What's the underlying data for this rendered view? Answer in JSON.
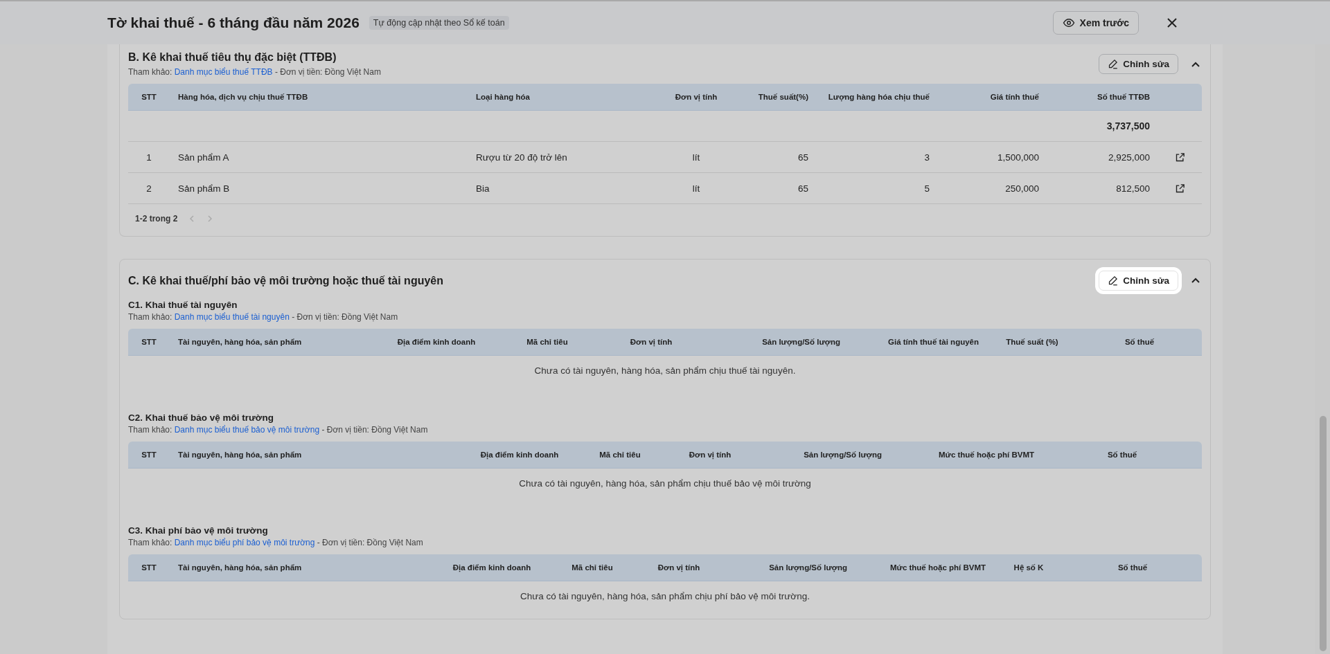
{
  "header": {
    "title": "Tờ khai thuế - 6 tháng đầu năm 2026",
    "badge": "Tự động cập nhật theo Sổ kế toán",
    "preview_button": "Xem trước"
  },
  "sections": [
    {
      "kind": "table",
      "title": "B. Kê khai thuế tiêu thụ đặc biệt (TTĐB)",
      "reference": {
        "prefix": "Tham khảo:",
        "link": "Danh mục biểu thuế TTĐB",
        "suffix": "- Đơn vị tiền: Đồng Việt Nam"
      },
      "edit_button": {
        "label": "Chỉnh sửa",
        "highlighted": false
      },
      "expanded": true,
      "table": {
        "columns": [
          "STT",
          "Hàng hóa, dịch vụ chịu thuế TTĐB",
          "Loại hàng hóa",
          "Đơn vị tính",
          "Thuế suất(%)",
          "Lượng hàng hóa chịu thuế",
          "Giá tính thuế",
          "Số thuế TTĐB"
        ],
        "total": "3,737,500",
        "rows": [
          {
            "cells": [
              "1",
              "Sản phẩm A",
              "Rượu từ 20 độ trở lên",
              "lít",
              "65",
              "3",
              "1,500,000",
              "2,925,000"
            ]
          },
          {
            "cells": [
              "2",
              "Sản phẩm B",
              "Bia",
              "lít",
              "65",
              "5",
              "250,000",
              "812,500"
            ]
          }
        ],
        "pagination": "1-2 trong 2"
      }
    },
    {
      "kind": "groups",
      "title": "C. Kê khai thuế/phí bảo vệ môi trường hoặc thuế tài nguyên",
      "edit_button": {
        "label": "Chỉnh sửa",
        "highlighted": true
      },
      "expanded": true,
      "subsections": [
        {
          "title": "C1. Khai thuế tài nguyên",
          "reference": {
            "prefix": "Tham khảo:",
            "link": "Danh mục biểu thuế tài nguyên",
            "suffix": "- Đơn vị tiền: Đồng Việt Nam"
          },
          "table": {
            "columns": [
              "STT",
              "Tài nguyên, hàng hóa, sản phẩm",
              "Địa điểm kinh doanh",
              "Mã chỉ tiêu",
              "Đơn vị tính",
              "Sản lượng/Số lượng",
              "Giá tính thuế tài nguyên",
              "Thuế suất (%)",
              "Số thuế"
            ],
            "empty_message": "Chưa có tài nguyên, hàng hóa, sản phẩm chịu thuế tài nguyên."
          }
        },
        {
          "title": "C2. Khai thuế bảo vệ môi trường",
          "reference": {
            "prefix": "Tham khảo:",
            "link": "Danh mục biểu thuế bảo vệ môi trường",
            "suffix": "- Đơn vị tiền: Đồng Việt Nam"
          },
          "table": {
            "columns": [
              "STT",
              "Tài nguyên, hàng hóa, sản phẩm",
              "Địa điểm kinh doanh",
              "Mã chỉ tiêu",
              "Đơn vị tính",
              "Sản lượng/Số lượng",
              "Mức thuế hoặc phí BVMT",
              "Số thuế"
            ],
            "empty_message": "Chưa có tài nguyên, hàng hóa, sản phẩm chịu thuế bảo vệ môi trường"
          }
        },
        {
          "title": "C3. Khai phí bảo vệ môi trường",
          "reference": {
            "prefix": "Tham khảo:",
            "link": "Danh mục biểu phí bảo vệ môi trường",
            "suffix": "- Đơn vị tiền: Đồng Việt Nam"
          },
          "table": {
            "columns": [
              "STT",
              "Tài nguyên, hàng hóa, sản phẩm",
              "Địa điểm kinh doanh",
              "Mã chỉ tiêu",
              "Đơn vị tính",
              "Sản lượng/Số lượng",
              "Mức thuế hoặc phí BVMT",
              "Hệ số K",
              "Số thuế"
            ],
            "empty_message": "Chưa có tài nguyên, hàng hóa, sản phẩm chịu phí bảo vệ môi trường."
          }
        }
      ]
    }
  ]
}
